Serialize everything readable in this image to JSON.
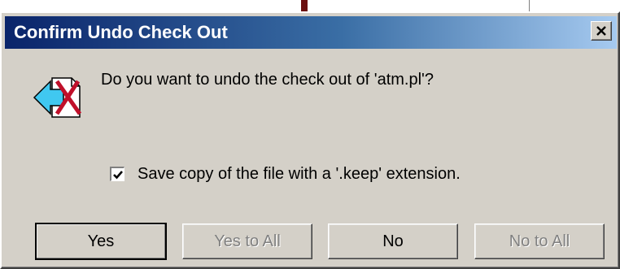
{
  "dialog": {
    "title": "Confirm Undo Check Out",
    "message": "Do you want to undo the check out of 'atm.pl'?",
    "checkbox": {
      "label": "Save copy of the file with a '.keep' extension.",
      "checked": true
    },
    "buttons": {
      "yes": "Yes",
      "yes_to_all": "Yes to All",
      "no": "No",
      "no_to_all": "No to All"
    },
    "icon": "undo-checkout-icon",
    "close_icon": "close-icon"
  },
  "colors": {
    "titlebar_start": "#0a246a",
    "titlebar_end": "#a6caf0",
    "dialog_face": "#d4d0c8",
    "disabled_text": "#808080"
  }
}
